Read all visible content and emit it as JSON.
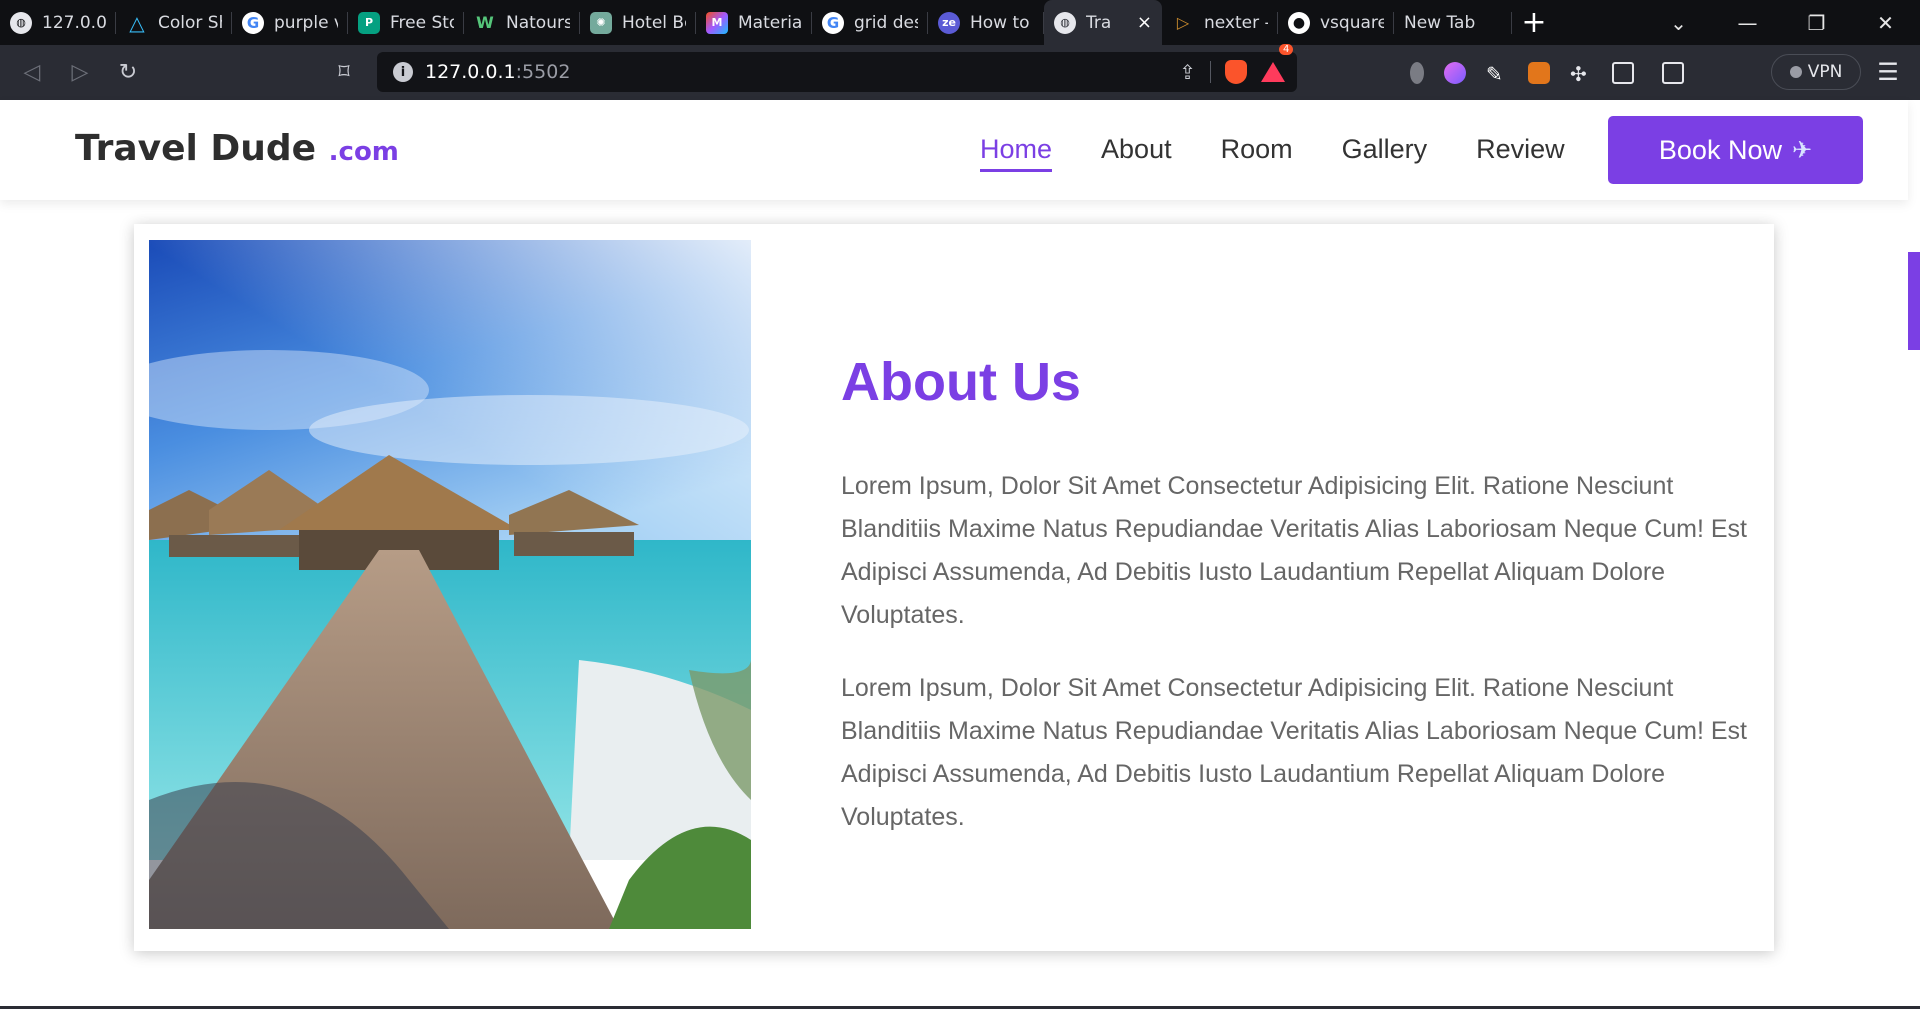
{
  "browser": {
    "tabs": [
      {
        "title": "127.0.0.",
        "icon": "globe-icon",
        "color": "#e6e7ec"
      },
      {
        "title": "Color Sh",
        "icon": "triangle-logo-icon",
        "color": "#38bdf8"
      },
      {
        "title": "purple v",
        "icon": "google-icon",
        "color": "#ffffff"
      },
      {
        "title": "Free Sto",
        "icon": "pexels-icon",
        "color": "#05a081"
      },
      {
        "title": "Natours",
        "icon": "natours-icon",
        "color": "#55c57a"
      },
      {
        "title": "Hotel Bo",
        "icon": "chatgpt-icon",
        "color": "#74aa9c"
      },
      {
        "title": "Material",
        "icon": "figma-icon",
        "color": "#a259ff"
      },
      {
        "title": "grid des",
        "icon": "google-icon",
        "color": "#ffffff"
      },
      {
        "title": "How to",
        "icon": "ze-icon",
        "color": "#5b5bd6"
      },
      {
        "title": "Tra",
        "icon": "globe-icon",
        "color": "#e6e7ec",
        "active": true
      },
      {
        "title": "nexter -",
        "icon": "play-icon",
        "color": "#c98a2e"
      },
      {
        "title": "vsquare",
        "icon": "github-icon",
        "color": "#ffffff"
      },
      {
        "title": "New Tab",
        "icon": "",
        "color": ""
      }
    ],
    "close_glyph": "×",
    "newtab_glyph": "+",
    "url_host": "127.0.0.1",
    "url_port": ":5502",
    "vpn_label": "VPN",
    "bat_badge": "4"
  },
  "site": {
    "logo_main": "Travel Dude",
    "logo_domain": ".com",
    "nav": [
      "Home",
      "About",
      "Room",
      "Gallery",
      "Review"
    ],
    "book_label": "Book Now",
    "accent": "#7b3fe4"
  },
  "about": {
    "title": "About Us",
    "paragraphs": [
      "Lorem Ipsum, Dolor Sit Amet Consectetur Adipisicing Elit. Ratione Nesciunt Blanditiis Maxime Natus Repudiandae Veritatis Alias Laboriosam Neque Cum! Est Adipisci Assumenda, Ad Debitis Iusto Laudantium Repellat Aliquam Dolore Voluptates.",
      "Lorem Ipsum, Dolor Sit Amet Consectetur Adipisicing Elit. Ratione Nesciunt Blanditiis Maxime Natus Repudiandae Veritatis Alias Laboriosam Neque Cum! Est Adipisci Assumenda, Ad Debitis Iusto Laudantium Repellat Aliquam Dolore Voluptates."
    ]
  }
}
